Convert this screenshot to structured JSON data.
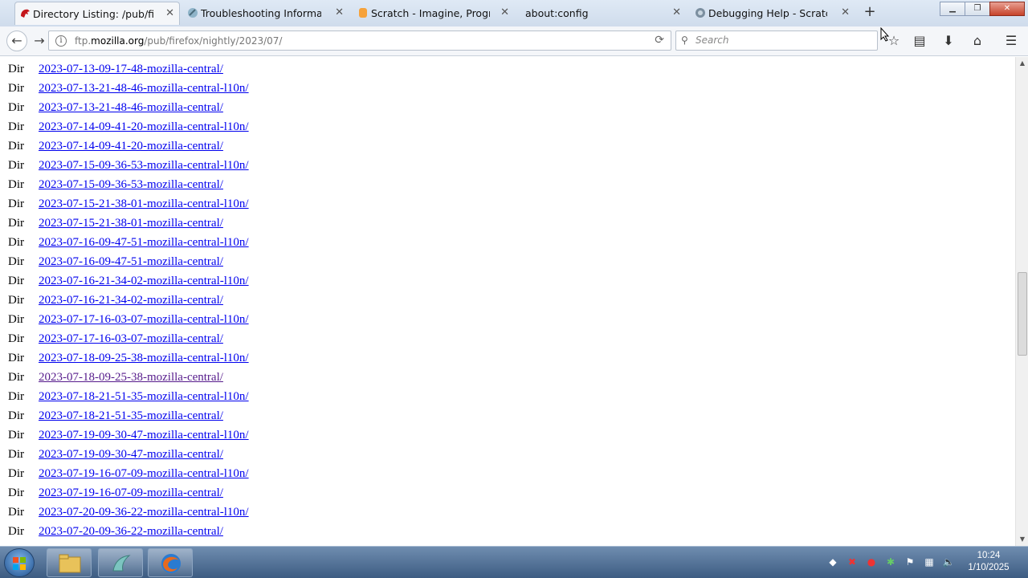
{
  "tabs": [
    {
      "title": "Directory Listing: /pub/firefo",
      "active": true,
      "favicon": "mozilla-dino-icon"
    },
    {
      "title": "Troubleshooting Informatio",
      "active": false,
      "favicon": "wrench-globe-icon"
    },
    {
      "title": "Scratch - Imagine, Program,",
      "active": false,
      "favicon": "scratch-icon"
    },
    {
      "title": "about:config",
      "active": false,
      "favicon": "none"
    },
    {
      "title": "Debugging Help - Scratch W",
      "active": false,
      "favicon": "globe-icon"
    }
  ],
  "nav": {
    "url_pre": "ftp.",
    "url_host": "mozilla.org",
    "url_post": "/pub/firefox/nightly/2023/07/",
    "search_placeholder": "Search"
  },
  "listing": [
    {
      "kind": "Dir",
      "name": "2023-07-13-09-17-48-mozilla-central/"
    },
    {
      "kind": "Dir",
      "name": "2023-07-13-21-48-46-mozilla-central-l10n/"
    },
    {
      "kind": "Dir",
      "name": "2023-07-13-21-48-46-mozilla-central/"
    },
    {
      "kind": "Dir",
      "name": "2023-07-14-09-41-20-mozilla-central-l10n/"
    },
    {
      "kind": "Dir",
      "name": "2023-07-14-09-41-20-mozilla-central/"
    },
    {
      "kind": "Dir",
      "name": "2023-07-15-09-36-53-mozilla-central-l10n/"
    },
    {
      "kind": "Dir",
      "name": "2023-07-15-09-36-53-mozilla-central/"
    },
    {
      "kind": "Dir",
      "name": "2023-07-15-21-38-01-mozilla-central-l10n/"
    },
    {
      "kind": "Dir",
      "name": "2023-07-15-21-38-01-mozilla-central/"
    },
    {
      "kind": "Dir",
      "name": "2023-07-16-09-47-51-mozilla-central-l10n/"
    },
    {
      "kind": "Dir",
      "name": "2023-07-16-09-47-51-mozilla-central/"
    },
    {
      "kind": "Dir",
      "name": "2023-07-16-21-34-02-mozilla-central-l10n/"
    },
    {
      "kind": "Dir",
      "name": "2023-07-16-21-34-02-mozilla-central/"
    },
    {
      "kind": "Dir",
      "name": "2023-07-17-16-03-07-mozilla-central-l10n/"
    },
    {
      "kind": "Dir",
      "name": "2023-07-17-16-03-07-mozilla-central/"
    },
    {
      "kind": "Dir",
      "name": "2023-07-18-09-25-38-mozilla-central-l10n/"
    },
    {
      "kind": "Dir",
      "name": "2023-07-18-09-25-38-mozilla-central/",
      "visited": true
    },
    {
      "kind": "Dir",
      "name": "2023-07-18-21-51-35-mozilla-central-l10n/"
    },
    {
      "kind": "Dir",
      "name": "2023-07-18-21-51-35-mozilla-central/"
    },
    {
      "kind": "Dir",
      "name": "2023-07-19-09-30-47-mozilla-central-l10n/"
    },
    {
      "kind": "Dir",
      "name": "2023-07-19-09-30-47-mozilla-central/"
    },
    {
      "kind": "Dir",
      "name": "2023-07-19-16-07-09-mozilla-central-l10n/"
    },
    {
      "kind": "Dir",
      "name": "2023-07-19-16-07-09-mozilla-central/"
    },
    {
      "kind": "Dir",
      "name": "2023-07-20-09-36-22-mozilla-central-l10n/"
    },
    {
      "kind": "Dir",
      "name": "2023-07-20-09-36-22-mozilla-central/"
    }
  ],
  "taskbar": {
    "apps": [
      "folder-icon",
      "scratch-cat-icon",
      "firefox-icon"
    ],
    "tray_icons": [
      "network-app-icon",
      "x-red-icon",
      "search-red-icon",
      "green-app-icon",
      "flag-icon",
      "network-icon",
      "volume-icon"
    ]
  },
  "clock": {
    "time": "10:24",
    "date": "1/10/2025"
  },
  "colors": {
    "link": "#0000ee",
    "visited": "#551a8b",
    "taskbar": "#4a6b93"
  }
}
